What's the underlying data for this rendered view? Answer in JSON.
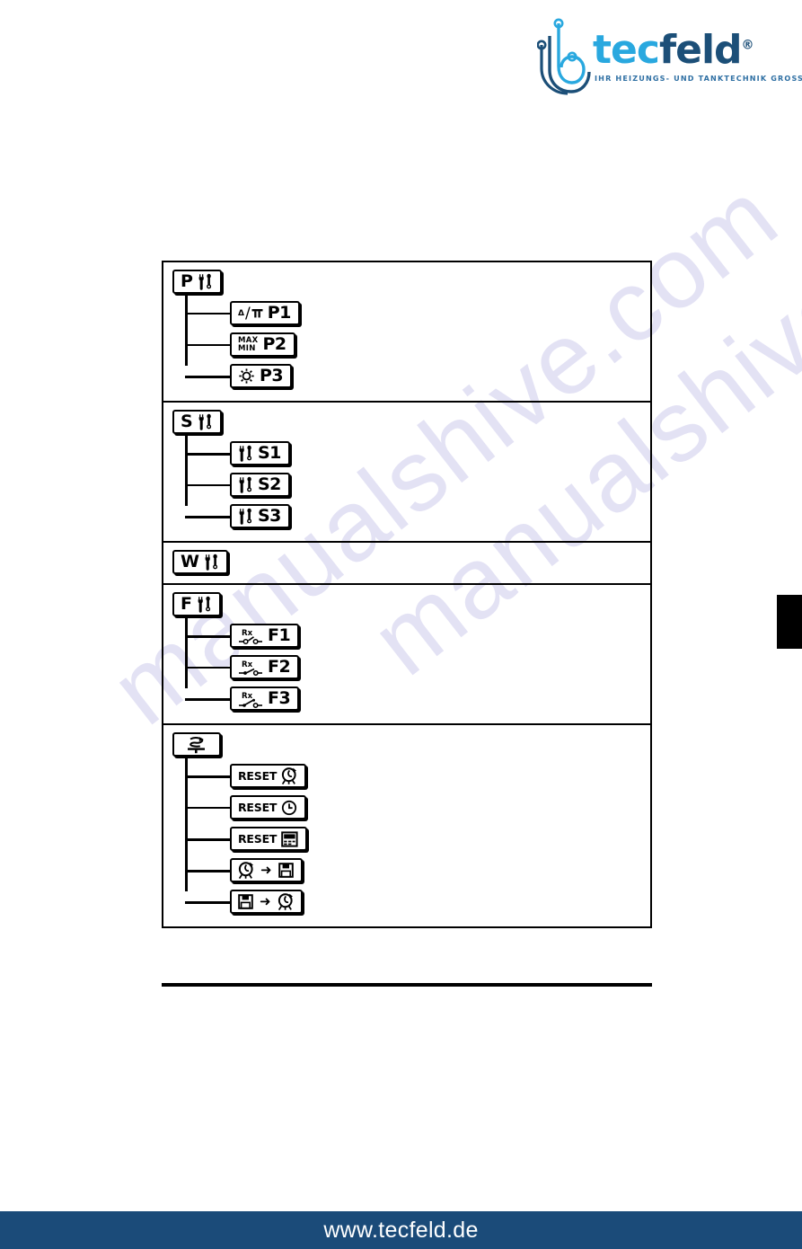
{
  "brand": {
    "name_part1": "tec",
    "name_part2": "feld",
    "registered": "®",
    "tagline": "IHR HEIZUNGS- UND TANKTECHNIK GROSSHANDEL",
    "colors": {
      "cyan": "#29a8df",
      "navy": "#1c4f78",
      "footer_bar": "#1b4b79"
    }
  },
  "watermark": {
    "line1": "manualshive.com",
    "line2": "manualshive.com"
  },
  "edge_tab": {
    "label": ""
  },
  "tree": {
    "groups": [
      {
        "header": {
          "letter": "P",
          "icon": "tools-icon"
        },
        "children": [
          {
            "icon": "delta-pressure-icon",
            "numerator": "Δ",
            "denominator": "p",
            "label": "P1"
          },
          {
            "icon": "max-min-icon",
            "line1": "MAX",
            "line2": "MIN",
            "label": "P2"
          },
          {
            "icon": "gear-icon",
            "label": "P3"
          }
        ]
      },
      {
        "header": {
          "letter": "S",
          "icon": "tools-icon"
        },
        "children": [
          {
            "icon": "tools-icon",
            "label": "S1"
          },
          {
            "icon": "tools-icon",
            "label": "S2"
          },
          {
            "icon": "tools-icon",
            "label": "S3"
          }
        ]
      },
      {
        "header": {
          "letter": "W",
          "icon": "tools-icon"
        },
        "children": []
      },
      {
        "header": {
          "letter": "F",
          "icon": "tools-icon"
        },
        "children": [
          {
            "icon": "relay-contact-open-icon",
            "sub": "Rx",
            "label": "F1"
          },
          {
            "icon": "relay-contact-closed-icon",
            "sub": "Rx",
            "label": "F2"
          },
          {
            "icon": "relay-contact-changeover-icon",
            "sub": "Rx",
            "label": "F3"
          }
        ]
      },
      {
        "header": {
          "letter": "",
          "icon": "service-hand-icon"
        },
        "children": [
          {
            "word": "RESET",
            "icon": "burner-icon"
          },
          {
            "word": "RESET",
            "icon": "clock-icon"
          },
          {
            "word": "RESET",
            "icon": "display-panel-icon"
          },
          {
            "word": "",
            "icon_left": "burner-icon",
            "arrow": "➜",
            "icon_right": "floppy-disk-icon"
          },
          {
            "word": "",
            "icon_left": "floppy-disk-icon",
            "arrow": "➜",
            "icon_right": "burner-icon"
          }
        ]
      }
    ]
  },
  "footer": {
    "url": "www.tecfeld.de"
  }
}
